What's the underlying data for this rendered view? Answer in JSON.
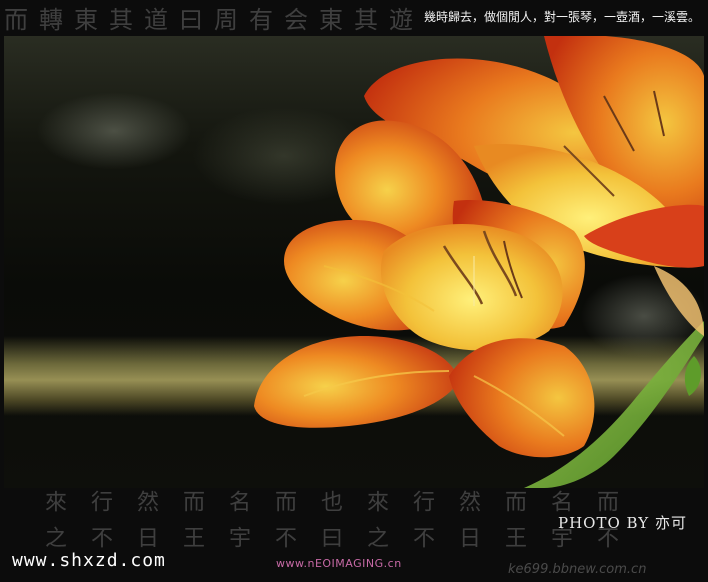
{
  "poem": "幾時歸去，做個閒人，對一張琴，一壺酒，一溪雲。",
  "photo_credit": "PHOTO BY 亦可",
  "site_url": "www.shxzd.com",
  "studio_mark": "www.nEOIMAGING.cn",
  "watermark": "ke699.bbnew.com.cn",
  "calligraphy_top": "而轉東其道曰周有会東其遊",
  "calligraphy_bottom_cols": [
    "來之",
    "行不",
    "然日",
    "而王",
    "名宇",
    "而不",
    "也曰",
    "來之",
    "行不",
    "然日",
    "而王",
    "名宇",
    "而不"
  ],
  "colors": {
    "petal_dark": "#c0290f",
    "petal_orange": "#e8741c",
    "petal_yellow": "#f2c93a",
    "stem": "#7fbf3a"
  },
  "image": {
    "subject": "Close-up of an orange and yellow lily-like flower"
  }
}
